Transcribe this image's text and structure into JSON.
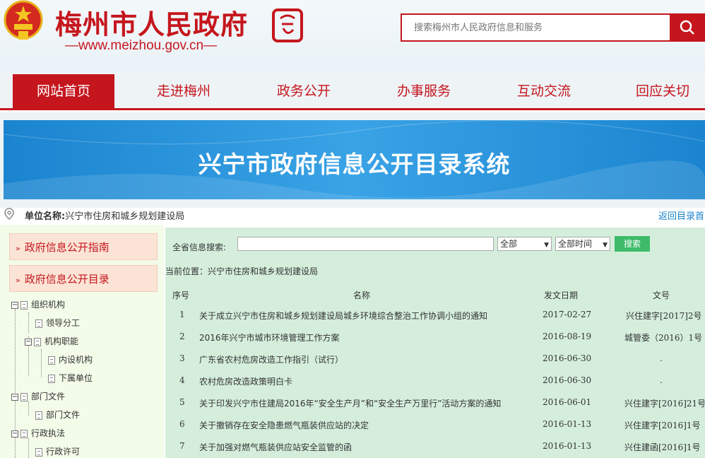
{
  "header": {
    "site_title": "梅州市人民政府",
    "site_url": "—www.meizhou.gov.cn—",
    "search_placeholder": "搜索梅州市人民政府信息和服务"
  },
  "nav": [
    {
      "label": "网站首页",
      "active": true
    },
    {
      "label": "走进梅州"
    },
    {
      "label": "政务公开"
    },
    {
      "label": "办事服务"
    },
    {
      "label": "互动交流"
    },
    {
      "label": "回应关切"
    }
  ],
  "banner": {
    "title": "兴宁市政府信息公开目录系统"
  },
  "unit": {
    "label": "单位名称:",
    "value": "兴宁市住房和城乡规划建设局",
    "back_link": "返回目录首"
  },
  "sidebar": {
    "guide": "政府信息公开指南",
    "catalog": "政府信息公开目录",
    "tree": {
      "org": "组织机构",
      "leader": "领导分工",
      "func": "机构职能",
      "internal": "内设机构",
      "sub": "下属单位",
      "dept": "部门文件",
      "dept_child": "部门文件",
      "law": "行政执法",
      "permit": "行政许可"
    }
  },
  "search": {
    "label": "全省信息搜索:",
    "scope": "全部",
    "time": "全部时间",
    "button": "搜索"
  },
  "location": "当前位置：兴宁市住房和城乡规划建设局",
  "table": {
    "headers": {
      "no": "序号",
      "name": "名称",
      "date": "发文日期",
      "doc": "文号"
    },
    "rows": [
      {
        "no": "1",
        "name": "关于成立兴宁市住房和城乡规划建设局城乡环境综合整治工作协调小组的通知",
        "date": "2017-02-27",
        "doc": "兴住建字[2017]2号"
      },
      {
        "no": "2",
        "name": "2016年兴宁市城市环境管理工作方案",
        "date": "2016-08-19",
        "doc": "城管委（2016）1号"
      },
      {
        "no": "3",
        "name": "广东省农村危房改造工作指引（试行）",
        "date": "2016-06-30",
        "doc": "."
      },
      {
        "no": "4",
        "name": "农村危房改造政策明白卡",
        "date": "2016-06-30",
        "doc": "."
      },
      {
        "no": "5",
        "name": "关于印发兴宁市住建局2016年“安全生产月”和“安全生产万里行”活动方案的通知",
        "date": "2016-06-01",
        "doc": "兴住建字[2016]21号"
      },
      {
        "no": "6",
        "name": "关于撤销存在安全隐患燃气瓶装供应站的决定",
        "date": "2016-01-13",
        "doc": "兴住建字[2016]1号"
      },
      {
        "no": "7",
        "name": "关于加强对燃气瓶装供应站安全监管的函",
        "date": "2016-01-13",
        "doc": "兴住建函[2016]1号"
      }
    ]
  },
  "colors": {
    "brand_red": "#c5161d",
    "banner_blue": "#1a84cf",
    "table_bg": "#d5eedc",
    "search_green": "#3dbb6a"
  }
}
